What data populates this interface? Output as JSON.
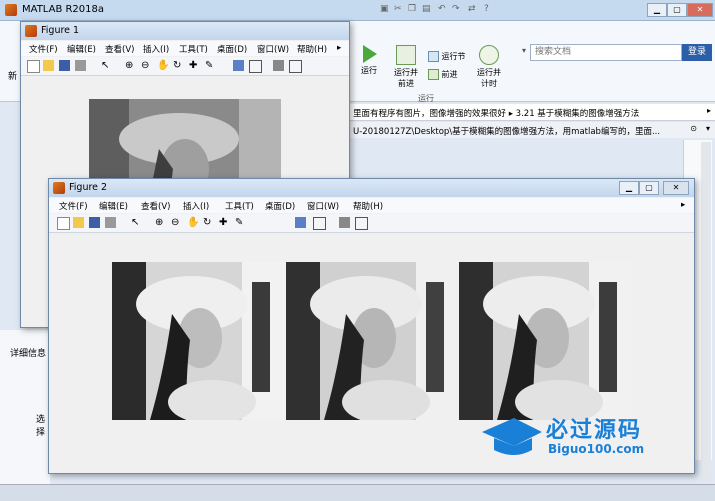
{
  "matlab": {
    "title": "MATLAB R2018a",
    "search_placeholder": "搜索文档",
    "login": "登录",
    "run_section_label": "运行",
    "run_buttons": [
      "运行",
      "运行并\n前进",
      "运行节",
      "前进",
      "运行并\n计时"
    ],
    "path_bar": "里面有程序有图片，图像增强的效果很好  ▸  3.21 基于模糊集的图像增强方法",
    "path_bar2": "U-20180127Z\\Desktop\\基于模糊集的图像增强方法，用matlab编写的，里面...",
    "details_label": "详细信息",
    "select_label": "选择",
    "left_label": "新"
  },
  "figure1": {
    "title": "Figure 1",
    "menus": [
      "文件(F)",
      "编辑(E)",
      "查看(V)",
      "插入(I)",
      "工具(T)",
      "桌面(D)",
      "窗口(W)",
      "帮助(H)"
    ]
  },
  "figure2": {
    "title": "Figure 2",
    "menus": [
      "文件(F)",
      "编辑(E)",
      "查看(V)",
      "插入(I)",
      "工具(T)",
      "桌面(D)",
      "窗口(W)",
      "帮助(H)"
    ]
  },
  "watermark": {
    "logo_text": "必过源码",
    "url": "Biguo100.com"
  },
  "colors": {
    "accent": "#2d5fa8",
    "watermark": "#1a7fd6"
  }
}
